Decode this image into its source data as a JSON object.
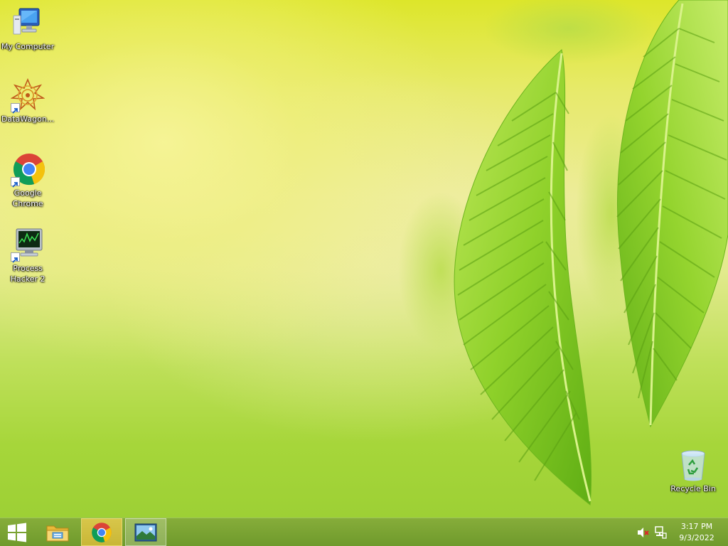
{
  "desktop": {
    "icons": [
      {
        "id": "my-computer",
        "label": "My Computer",
        "icon": "computer-icon",
        "shortcut": false
      },
      {
        "id": "datawagon",
        "label": "DataWagon...",
        "icon": "datawagon-icon",
        "shortcut": true
      },
      {
        "id": "google-chrome",
        "label": "Google\nChrome",
        "icon": "chrome-icon",
        "shortcut": true
      },
      {
        "id": "process-hacker",
        "label": "Process\nHacker 2",
        "icon": "process-hacker-icon",
        "shortcut": true
      },
      {
        "id": "recycle-bin",
        "label": "Recycle Bin",
        "icon": "recycle-bin-icon",
        "shortcut": false
      }
    ]
  },
  "taskbar": {
    "start": {
      "icon": "windows-logo-icon"
    },
    "pinned": [
      {
        "id": "file-explorer",
        "icon": "file-explorer-icon",
        "active": false
      },
      {
        "id": "chrome",
        "icon": "chrome-icon",
        "active": true
      },
      {
        "id": "photos",
        "icon": "photo-viewer-icon",
        "active": false
      }
    ],
    "tray": {
      "volume_icon": "volume-muted-icon",
      "network_icon": "network-icon"
    },
    "clock": {
      "time": "3:17 PM",
      "date": "9/3/2022"
    }
  },
  "colors": {
    "taskbar": "#7aa332",
    "active_task": "#d1bf40",
    "wallpaper_light": "#ecec96",
    "wallpaper_green": "#a6d63a"
  }
}
